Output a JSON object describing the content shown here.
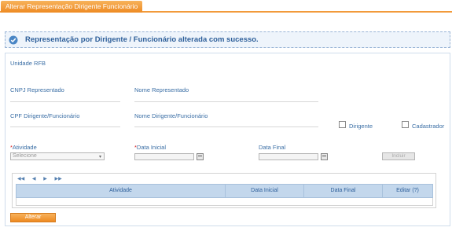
{
  "tab": {
    "title": "Alterar Representação Dirigente Funcionário"
  },
  "message": {
    "icon": "check-circle-icon",
    "text": "Representação por Dirigente / Funcionário alterada com sucesso."
  },
  "form": {
    "unidade_label": "Unidade RFB",
    "cnpj_label": "CNPJ Representado",
    "nome_representado_label": "Nome Representado",
    "cpf_label": "CPF Dirigente/Funcionário",
    "nome_dirigente_label": "Nome Dirigente/Funcionário",
    "dirigente_checkbox_label": "Dirigente",
    "cadastrador_checkbox_label": "Cadastrador",
    "required_marker": "*",
    "atividade_label": "Atividade",
    "atividade_value": "Selecione",
    "data_inicial_label": "Data Inicial",
    "data_final_label": "Data Final",
    "incluir_label": "Incluir"
  },
  "grid": {
    "pager": [
      "◀◀",
      "◀",
      "▶",
      "▶▶"
    ],
    "columns": [
      "Atividade",
      "Data Inicial",
      "Data Final",
      "Editar (?)"
    ]
  },
  "actions": {
    "alterar_label": "Alterar"
  },
  "colors": {
    "accent": "#ee8a22",
    "label": "#3a6ea5",
    "header_bg": "#c3d7ec"
  }
}
